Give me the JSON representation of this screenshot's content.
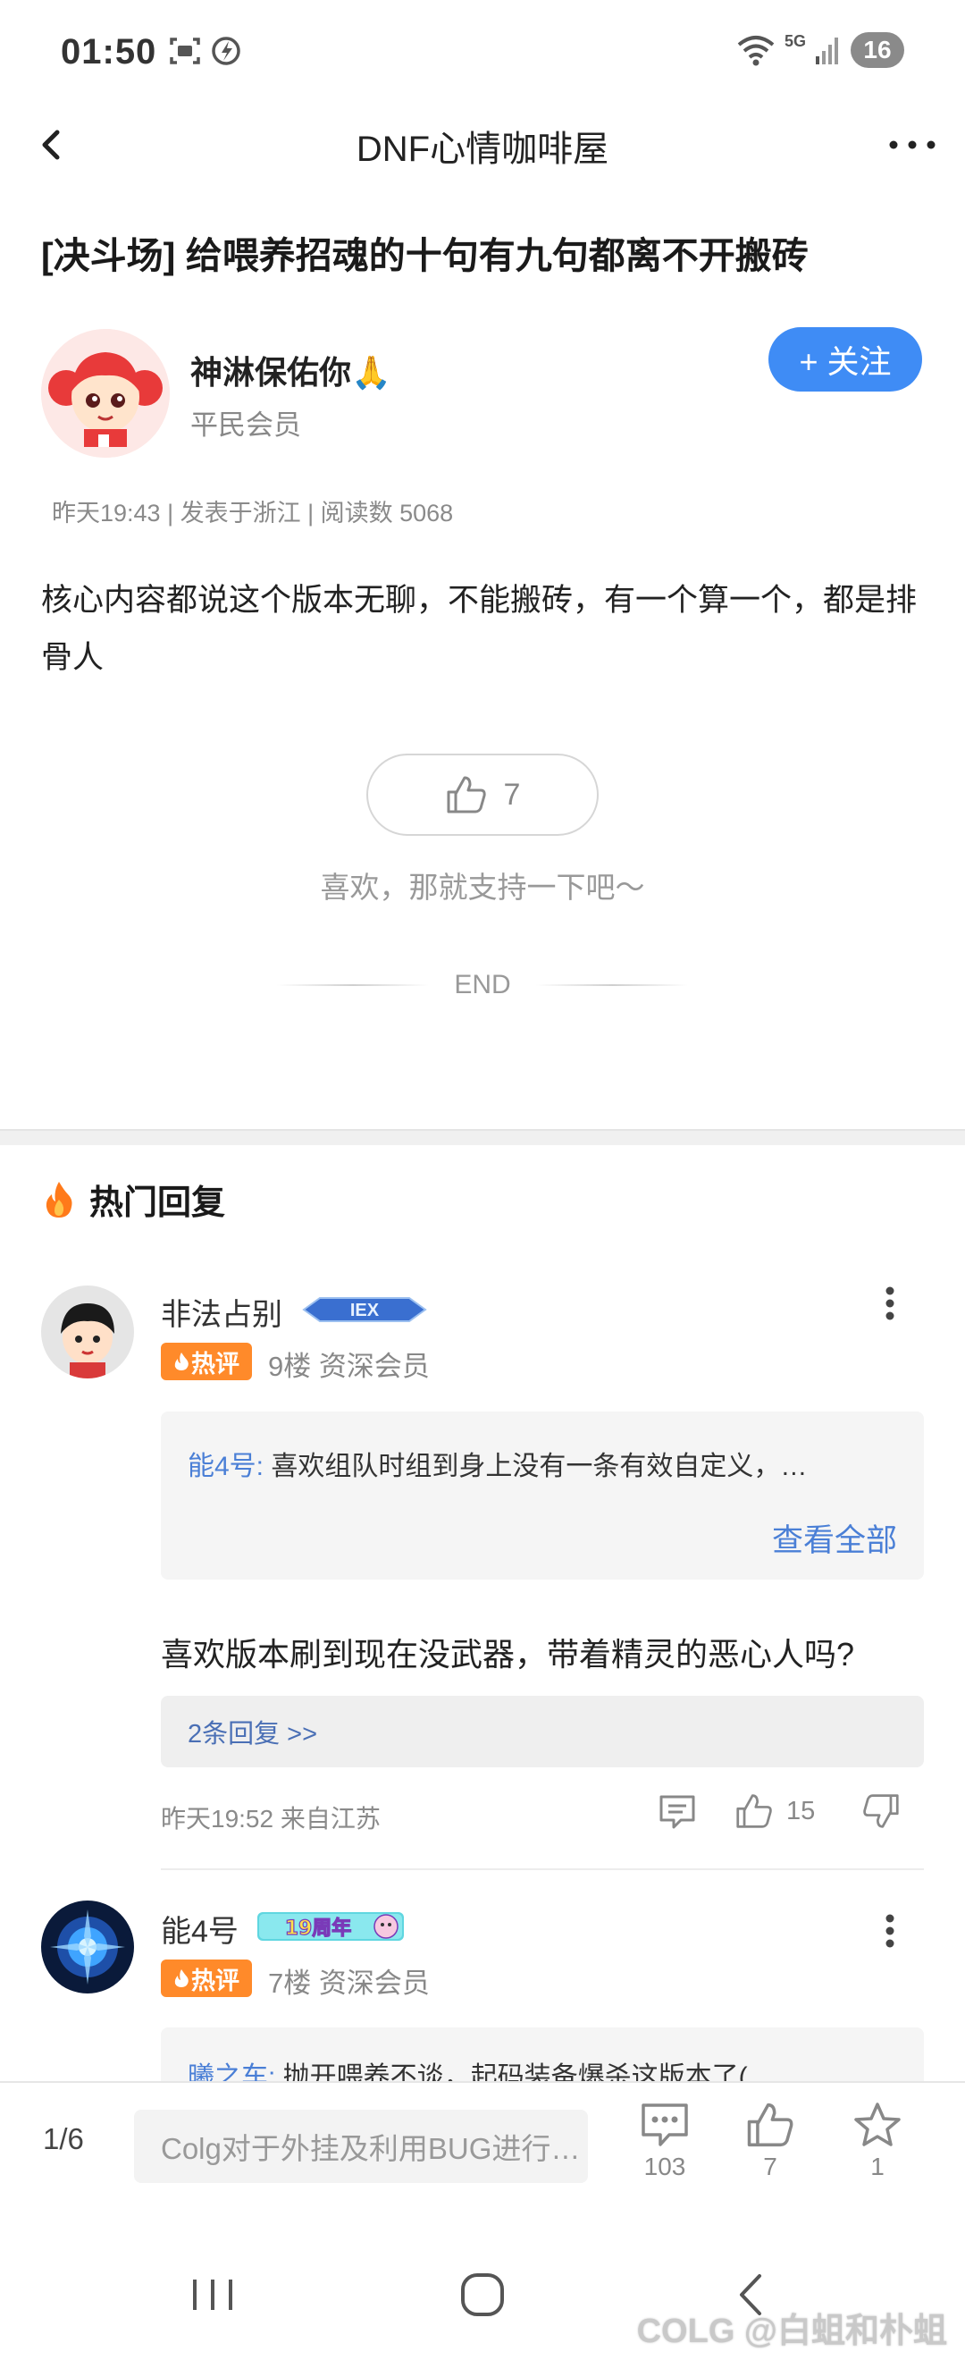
{
  "status_bar": {
    "time": "01:50",
    "network": "5G",
    "battery": "16",
    "icons": [
      "screenshot-icon",
      "data-saver-icon",
      "wifi-icon",
      "signal-icon"
    ]
  },
  "nav": {
    "title": "DNF心情咖啡屋"
  },
  "post": {
    "title": "[决斗场] 给喂养招魂的十句有九句都离不开搬砖",
    "author_name": "神淋保佑你🙏",
    "author_role": "平民会员",
    "follow_label": "+ 关注",
    "meta": "昨天19:43 | 发表于浙江 | 阅读数 5068",
    "body": "核心内容都说这个版本无聊，不能搬砖，有一个算一个，都是排骨人",
    "like_count": "7",
    "like_hint": "喜欢，那就支持一下吧～",
    "end_label": "END"
  },
  "hot_replies": {
    "header": "热门回复",
    "items": [
      {
        "name": "非法占别",
        "badge": "IEX",
        "hot_tag": "热评",
        "floor": "9楼 资深会员",
        "quote_user": "能4号:",
        "quote_text": "喜欢组队时组到身上没有一条有效自定义，…",
        "view_all": "查看全部",
        "text": "喜欢版本刷到现在没武器，带着精灵的恶心人吗?",
        "replies": "2条回复 >>",
        "meta": "昨天19:52 来自江苏",
        "likes": "15"
      },
      {
        "name": "能4号",
        "badge": "19周年",
        "hot_tag": "热评",
        "floor": "7楼 资深会员",
        "quote_user": "曦之车:",
        "quote_text": "抛开喂养不谈，起码装备爆杀这版本了("
      }
    ]
  },
  "bottom_bar": {
    "page": "1/6",
    "input_placeholder": "Colg对于外挂及利用BUG进行…",
    "comments": "103",
    "likes": "7",
    "favorites": "1"
  },
  "watermark": "COLG @白蛆和朴蛆",
  "colors": {
    "accent": "#3f8cf5",
    "hot_tag": "#ff8a2a",
    "link": "#4a7fd6"
  }
}
